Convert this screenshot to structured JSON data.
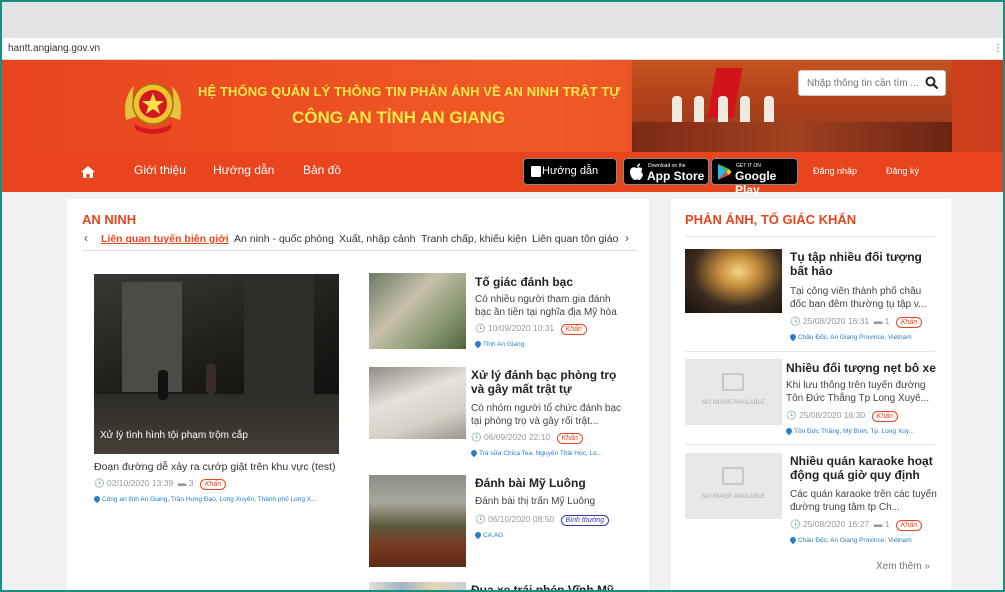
{
  "browser": {
    "url": "hantt.angiang.gov.vn",
    "menu_glyph": "⋮"
  },
  "header": {
    "title_line1": "HỆ THỐNG QUẢN LÝ THÔNG TIN PHẢN ÁNH VỀ AN NINH TRẬT TỰ",
    "title_line2": "CÔNG AN TỈNH AN GIANG",
    "search_placeholder": "Nhập thông tin cần tìm ..."
  },
  "nav": {
    "items": [
      "Giới thiệu",
      "Hướng dẫn",
      "Bản đồ"
    ],
    "guide_button": "Hướng dẫn",
    "appstore_small": "Download on the",
    "appstore_big": "App Store",
    "googleplay_small": "GET IT ON",
    "googleplay_big": "Google Play",
    "login": "Đăng nhập",
    "register": "Đăng ký"
  },
  "left_section": {
    "title": "AN NINH",
    "tabs": [
      "Liên quan tuyến biên giới",
      "An ninh - quốc phòng",
      "Xuất, nhập cảnh",
      "Tranh chấp, khiếu kiện",
      "Liên quan tôn giáo"
    ],
    "featured": {
      "image_caption": "Xử lý tình hình tội phạm trộm cắp",
      "title": "Đoạn đường dễ xảy ra cướp giật trên khu vực (test)",
      "date": "02/10/2020 13:39",
      "comments": "3",
      "badge": "Khẩn",
      "location": "Công an tỉnh An Giang, Trần Hưng Đạo, Long Xuyên, Thành phố Long X..."
    },
    "news": [
      {
        "title": "Tố giác đánh bạc",
        "desc": "Có nhiều người tham gia đánh bạc ăn tiền tại nghĩa địa Mỹ hòa",
        "date": "10/09/2020 10:31",
        "badge": "Khẩn",
        "location": "Tỉnh An Giang"
      },
      {
        "title": "Xử lý đánh bạc phòng trọ và gây mất trật tự",
        "desc": "Có nhóm người tổ chức đánh bạc tại phòng trọ và gây rối trật...",
        "date": "06/09/2020 22:10",
        "badge": "Khẩn",
        "location": "Trà sữa Chica Tea, Nguyễn Thái Học, Lo..."
      },
      {
        "title": "Đánh bài Mỹ Luông",
        "desc": "Đánh bài thị trấn Mỹ Luông",
        "date": "06/10/2020 08:50",
        "badge": "Bình thường",
        "location": "CA.AG"
      },
      {
        "title": "Đua xe trái phép Vĩnh Mỹ,"
      }
    ]
  },
  "right_section": {
    "title": "PHẢN ÁNH, TỐ GIÁC KHẨN",
    "no_image_text": "NO IMAGE AVAILABLE",
    "items": [
      {
        "title": "Tụ tập nhiều đối tượng bất hảo",
        "desc": "Tại công viên thành phố châu đốc ban đêm thường tụ tập v...",
        "date": "25/08/2020 16:31",
        "comments": "1",
        "badge": "Khẩn",
        "location": "Châu Đốc, An Giang Province, Vietnam"
      },
      {
        "title": "Nhiều đối tượng nẹt bô xe",
        "desc": "Khi lưu thông trên tuyến đường Tôn Đức Thắng Tp Long Xuyê...",
        "date": "25/08/2020 16:30",
        "badge": "Khẩn",
        "location": "Tôn Đức Thắng, Mỹ Bình, Tp. Long Xuy..."
      },
      {
        "title": "Nhiều quán karaoke hoạt động quá giờ quy định",
        "desc": "Các quán karaoke trên các tuyến đường trung tâm tp Ch...",
        "date": "25/08/2020 16:27",
        "comments": "1",
        "badge": "Khẩn",
        "location": "Châu Đốc, An Giang Province, Vietnam"
      }
    ],
    "more": "Xem thêm »"
  },
  "colors": {
    "brand_orange": "#e8441d",
    "title_yellow": "#ffe94a",
    "link_blue": "#2a7ec3"
  }
}
